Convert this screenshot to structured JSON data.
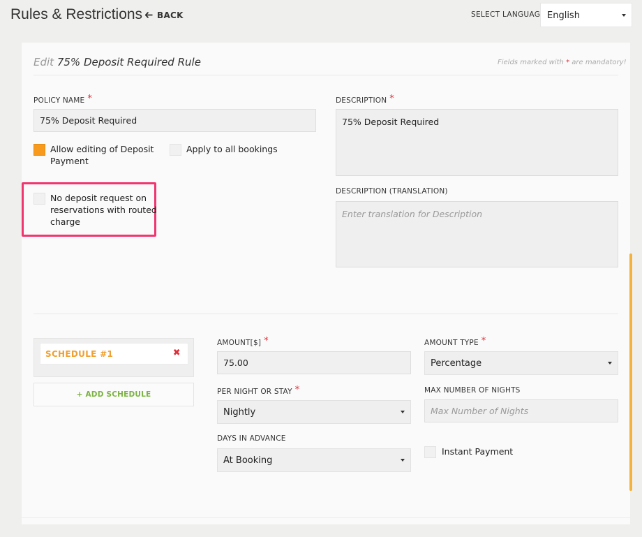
{
  "header": {
    "title": "Rules & Restrictions",
    "back_label": "BACK",
    "language_label": "SELECT LANGUAGE",
    "language_value": "English"
  },
  "form": {
    "edit_prefix": "Edit",
    "rule_name": "75% Deposit Required Rule",
    "mandatory_note_prefix": "Fields marked with",
    "mandatory_note_suffix": "are mandatory!",
    "policy_name_label": "POLICY NAME",
    "policy_name_value": "75% Deposit Required",
    "description_label": "DESCRIPTION",
    "description_value": "75% Deposit Required",
    "description_translation_label": "DESCRIPTION (TRANSLATION)",
    "description_translation_placeholder": "Enter translation for Description",
    "allow_editing_label_1": "Allow editing of Deposit",
    "allow_editing_label_2": "Payment",
    "allow_editing_checked": true,
    "apply_all_label": "Apply to all bookings",
    "apply_all_checked": false,
    "no_deposit_label_1": "No deposit request on",
    "no_deposit_label_2": "reservations with routed",
    "no_deposit_label_3": "charge",
    "no_deposit_checked": false
  },
  "schedule": {
    "item_label": "SCHEDULE #1",
    "add_label": "+ ADD SCHEDULE",
    "amount_label": "AMOUNT[$]",
    "amount_value": "75.00",
    "amount_type_label": "AMOUNT TYPE",
    "amount_type_value": "Percentage",
    "per_night_label": "PER NIGHT OR STAY",
    "per_night_value": "Nightly",
    "max_nights_label": "MAX NUMBER OF NIGHTS",
    "max_nights_placeholder": "Max Number of Nights",
    "days_advance_label": "DAYS IN ADVANCE",
    "days_advance_value": "At Booking",
    "instant_payment_label": "Instant Payment",
    "instant_payment_checked": false
  },
  "icons": {
    "back": "arrow-left-icon",
    "remove": "close-icon",
    "dropdown": "caret-down-icon"
  },
  "colors": {
    "accent_orange": "#f79a1e",
    "required_red": "#e0303a",
    "highlight_pink": "#f0356f",
    "add_green": "#7cb342"
  }
}
